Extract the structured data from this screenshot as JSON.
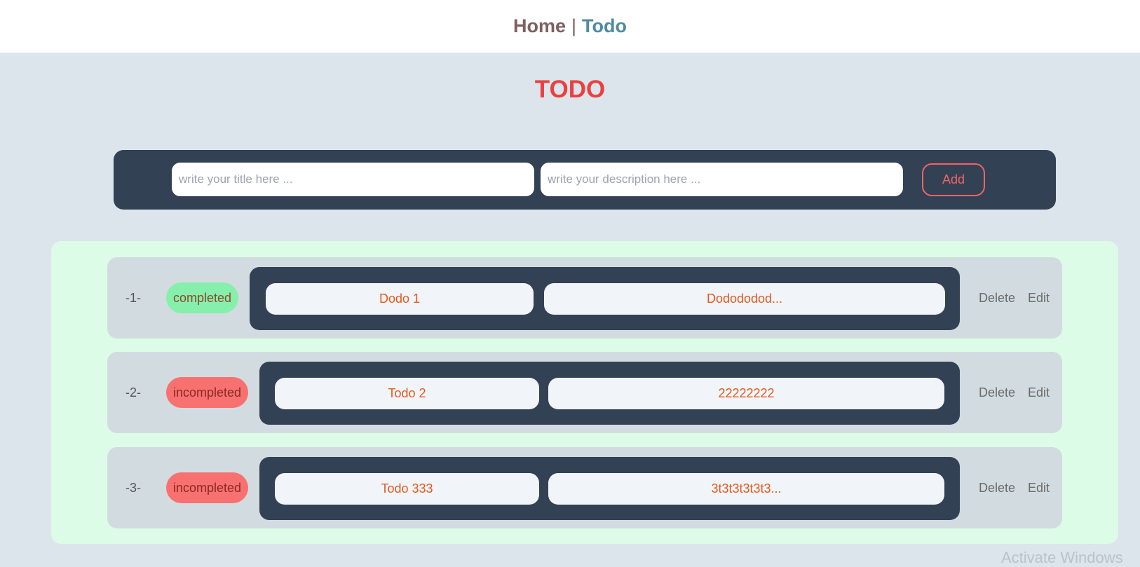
{
  "nav": {
    "home_label": "Home",
    "separator": "|",
    "todo_label": "Todo"
  },
  "page_title": "TODO",
  "add_form": {
    "title_placeholder": "write your title here ...",
    "description_placeholder": "write your description here ...",
    "add_label": "Add"
  },
  "todos": [
    {
      "index": "-1-",
      "status": "completed",
      "title": "Dodo 1",
      "description": "Dodododod...",
      "delete_label": "Delete",
      "edit_label": "Edit"
    },
    {
      "index": "-2-",
      "status": "incompleted",
      "title": "Todo 2",
      "description": "22222222",
      "delete_label": "Delete",
      "edit_label": "Edit"
    },
    {
      "index": "-3-",
      "status": "incompleted",
      "title": "Todo 333",
      "description": "3t3t3t3t3t3...",
      "delete_label": "Delete",
      "edit_label": "Edit"
    }
  ],
  "watermark": "Activate Windows",
  "colors": {
    "background": "#dbe5eb",
    "title_red": "#ea4040",
    "dark_panel": "#334155",
    "list_panel": "#dcfce7",
    "completed_badge": "#86efac",
    "incompleted_badge": "#f87171",
    "todo_text": "#e8571c"
  }
}
